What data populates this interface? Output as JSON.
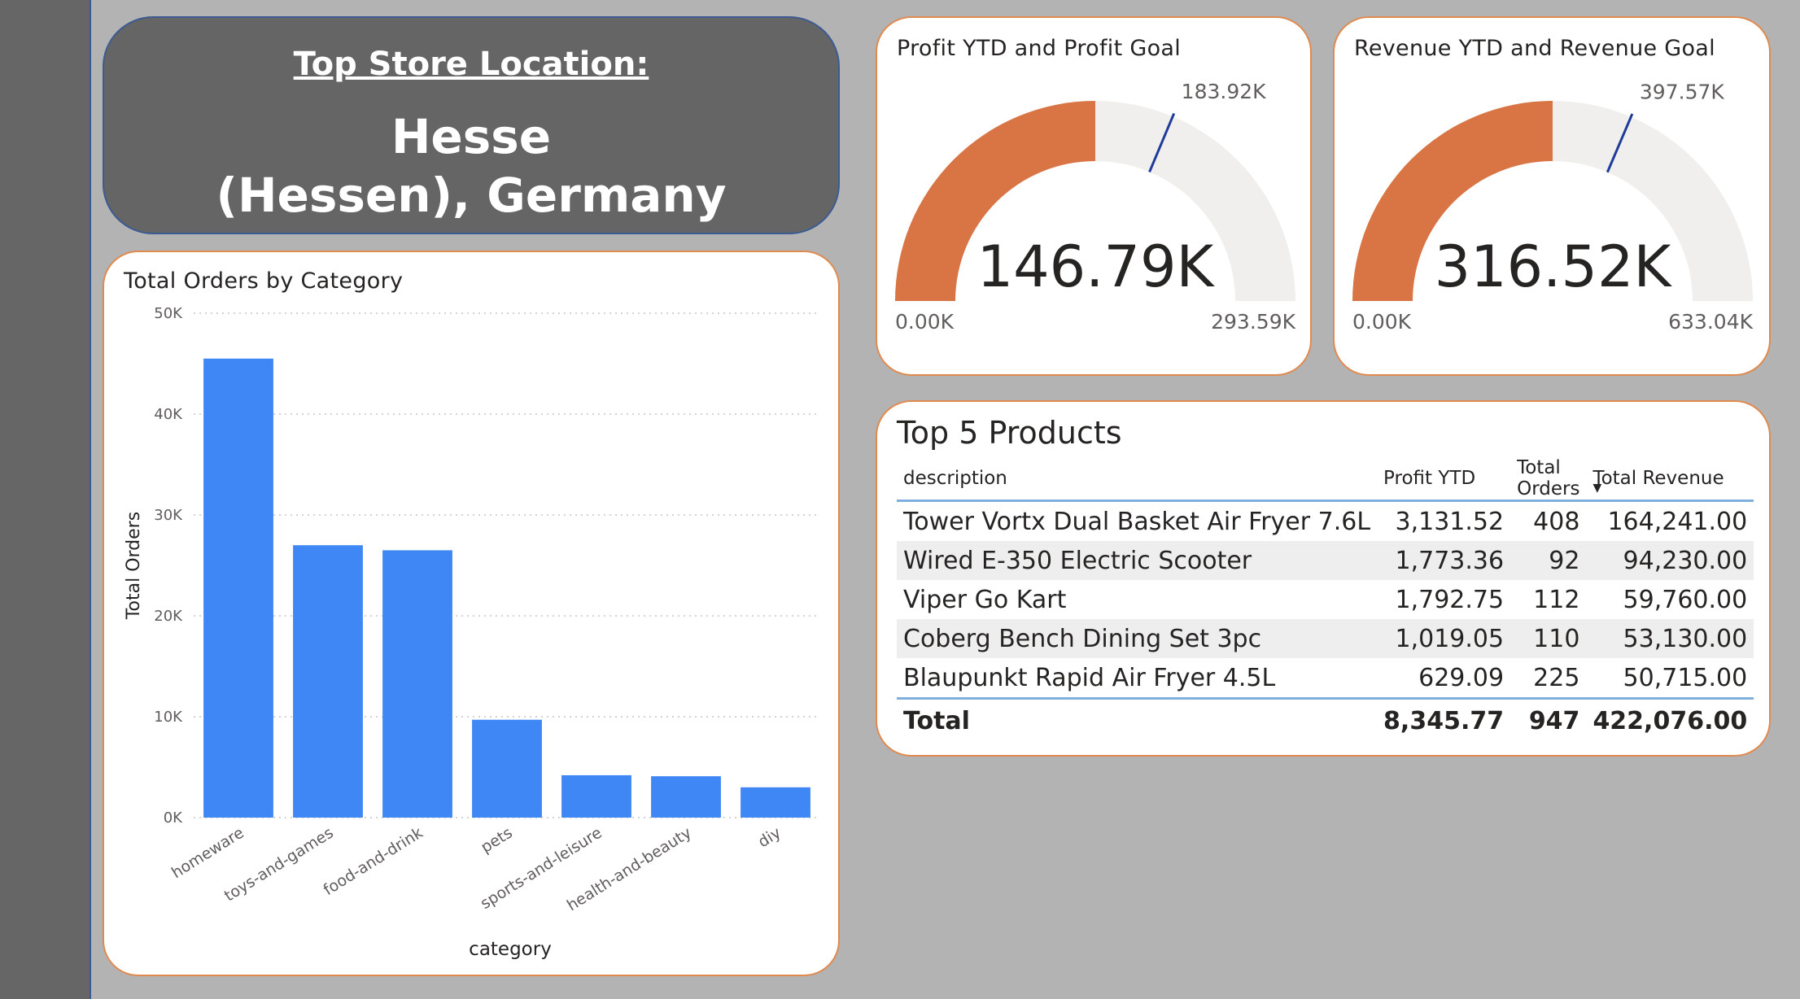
{
  "banner": {
    "label": "Top Store Location:",
    "value_line1": "Hesse",
    "value_line2": "(Hessen), Germany"
  },
  "profit_gauge": {
    "title": "Profit YTD and Profit Goal",
    "value": 146.79,
    "value_label": "146.79K",
    "target": 183.92,
    "target_label": "183.92K",
    "min": 0,
    "min_label": "0.00K",
    "max": 293.59,
    "max_label": "293.59K"
  },
  "revenue_gauge": {
    "title": "Revenue YTD and Revenue Goal",
    "value": 316.52,
    "value_label": "316.52K",
    "target": 397.57,
    "target_label": "397.57K",
    "min": 0,
    "min_label": "0.00K",
    "max": 633.04,
    "max_label": "633.04K"
  },
  "colors": {
    "bar": "#3f87f5",
    "gauge_fill": "#d97445",
    "gauge_track": "#f0efee",
    "target_line": "#1f3b99",
    "card_border": "#e08a4f"
  },
  "chart_data": {
    "type": "bar",
    "title": "Total Orders by Category",
    "xlabel": "category",
    "ylabel": "Total Orders",
    "categories": [
      "homeware",
      "toys-and-games",
      "food-and-drink",
      "pets",
      "sports-and-leisure",
      "health-and-beauty",
      "diy"
    ],
    "values": [
      45500,
      27000,
      26500,
      9700,
      4200,
      4100,
      3000
    ],
    "ylim": [
      0,
      50000
    ],
    "yticks": [
      0,
      10000,
      20000,
      30000,
      40000,
      50000
    ],
    "ytick_labels": [
      "0K",
      "10K",
      "20K",
      "30K",
      "40K",
      "50K"
    ],
    "grid": true
  },
  "top_products": {
    "title": "Top 5 Products",
    "columns": [
      "description",
      "Profit YTD",
      "Total Orders",
      "Total Revenue"
    ],
    "rows": [
      [
        "Tower Vortx Dual Basket Air Fryer 7.6L",
        "3,131.52",
        "408",
        "164,241.00"
      ],
      [
        "Wired E-350 Electric Scooter",
        "1,773.36",
        "92",
        "94,230.00"
      ],
      [
        "Viper Go Kart",
        "1,792.75",
        "112",
        "59,760.00"
      ],
      [
        "Coberg Bench Dining Set 3pc",
        "1,019.05",
        "110",
        "53,130.00"
      ],
      [
        "Blaupunkt Rapid Air Fryer 4.5L",
        "629.09",
        "225",
        "50,715.00"
      ]
    ],
    "total": [
      "Total",
      "8,345.77",
      "947",
      "422,076.00"
    ]
  }
}
